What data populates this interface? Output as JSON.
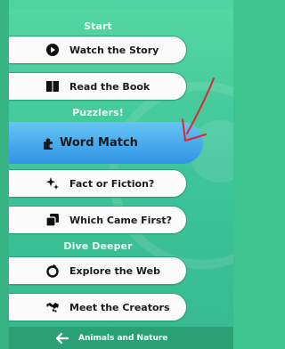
{
  "sections": {
    "start": "Start",
    "puzzlers": "Puzzlers!",
    "dive_deeper": "Dive Deeper"
  },
  "items": {
    "watch_story": "Watch the Story",
    "read_book": "Read the Book",
    "word_match": "Word Match",
    "fact_or_fiction": "Fact or Fiction?",
    "which_came_first": "Which Came First?",
    "explore_web": "Explore the Web",
    "meet_creators": "Meet the Creators"
  },
  "back": {
    "label": "Animals and Nature"
  },
  "colors": {
    "panel_green": "#3ec59a",
    "active_blue": "#2f95e5",
    "annotation_red": "#e0262a"
  },
  "icons": {
    "watch_story": "play-circle-icon",
    "read_book": "book-icon",
    "word_match": "puzzle-piece-icon",
    "fact_or_fiction": "sparkles-icon",
    "which_came_first": "stacked-cards-icon",
    "explore_web": "globe-icon",
    "meet_creators": "handshake-icon",
    "back": "arrow-left-icon"
  }
}
